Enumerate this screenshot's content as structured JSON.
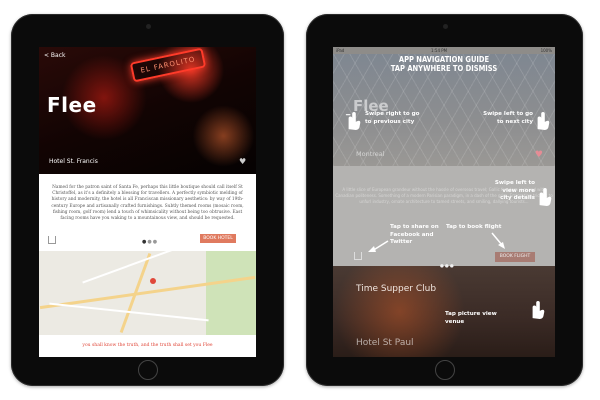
{
  "left": {
    "back_label": "< Back",
    "neon_sign": "EL FAROLITO",
    "title": "Flee",
    "hotel": "Hotel St. Francis",
    "description": "Named for the patron saint of Santa Fe, perhaps this little boutique should call itself St Christoffel, as it's a definitely a blessing for travellers. A perfectly symbiotic melding of history and modernity, the hotel is all Franciscan missionary aesthetics: by way of 19th-century Europe and artisanally crafted furnishings. Subtly themed rooms (mosaic room, fishing room, golf room) lend a touch of whimsicality without being too obtrusive. East facing rooms have you waking to a mountainous view, and should be requested.",
    "book_label": "BOOK HOTEL",
    "footer_quote": "you shall know the truth, and the truth shall set you Flee"
  },
  "right": {
    "status_left": "iPad",
    "status_time": "1:54 PM",
    "status_right": "100%",
    "guide_title_line1": "APP NAVIGATION GUIDE",
    "guide_title_line2": "TAP ANYWHERE TO DISMISS",
    "title": "Flee",
    "city": "Montreal",
    "tip_prev": "Swipe right to go to previous city",
    "tip_next": "Swipe left to go to next city",
    "tip_details": "Swipe left to view more city details",
    "tip_share": "Tap to share on Facebook and Twitter",
    "tip_book": "Tap to book flight",
    "tip_venue": "Tap picture view venue",
    "book_label": "BOOK FLIGHT",
    "venue_1": "Time Supper Club",
    "venue_2": "Hotel St Paul",
    "faded_text": "A little slice of European grandeur without the hassle of overseas travel; Gallic freedom is mixed with Canadian politeness. Something of a modern Parisian paradigm, in a dash of the grim. Emigrating trickles to unfurl industry, ornate architecture to tamed streets, and smiling, dallying tourists..."
  }
}
